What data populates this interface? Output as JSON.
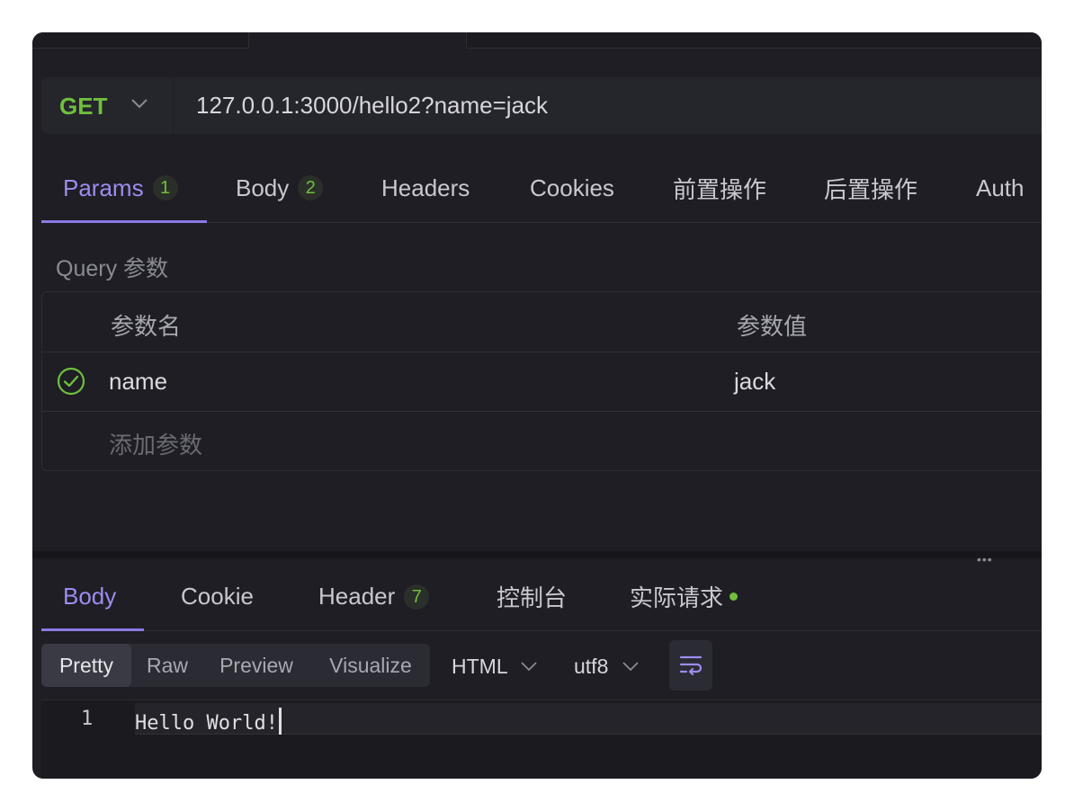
{
  "request": {
    "method": "GET",
    "url": "127.0.0.1:3000/hello2?name=jack"
  },
  "request_tabs": [
    {
      "label": "Params",
      "badge": "1",
      "active": true
    },
    {
      "label": "Body",
      "badge": "2"
    },
    {
      "label": "Headers"
    },
    {
      "label": "Cookies"
    },
    {
      "label": "前置操作"
    },
    {
      "label": "后置操作"
    },
    {
      "label": "Auth"
    }
  ],
  "query": {
    "section_label": "Query 参数",
    "col_name": "参数名",
    "col_value": "参数值",
    "rows": [
      {
        "name": "name",
        "value": "jack",
        "enabled": true
      }
    ],
    "add_placeholder": "添加参数"
  },
  "divider_handle": "•••",
  "response_tabs": [
    {
      "label": "Body",
      "active": true
    },
    {
      "label": "Cookie"
    },
    {
      "label": "Header",
      "badge": "7"
    },
    {
      "label": "控制台"
    },
    {
      "label": "实际请求",
      "dot": true
    }
  ],
  "view_modes": [
    "Pretty",
    "Raw",
    "Preview",
    "Visualize"
  ],
  "active_view_mode": "Pretty",
  "format": "HTML",
  "encoding": "utf8",
  "response_body": {
    "line_number": "1",
    "text": "Hello World!"
  },
  "colors": {
    "accent": "#8b79e6",
    "method_green": "#6fbf3c",
    "background": "#1e1e24"
  },
  "icons": {
    "method_dropdown": "chevron-down-icon",
    "row_enabled": "check-circle-icon",
    "wrap": "word-wrap-icon"
  }
}
